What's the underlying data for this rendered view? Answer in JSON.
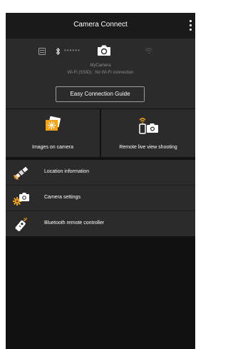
{
  "header": {
    "title": "Camera Connect"
  },
  "connection": {
    "dots": "••••••",
    "camera_name": "MyCamera",
    "ssid_line": "Wi-Fi (SSID) : No Wi-Fi connection",
    "guide_button": "Easy Connection Guide",
    "icons": [
      "camera-list-icon",
      "bluetooth-icon",
      "camera-icon",
      "wifi-icon"
    ]
  },
  "tiles": [
    {
      "label": "Images on camera",
      "icon": "images-icon"
    },
    {
      "label": "Remote live view shooting",
      "icon": "remote-live-view-icon"
    }
  ],
  "menu": [
    {
      "label": "Location information",
      "icon": "satellite-icon"
    },
    {
      "label": "Camera settings",
      "icon": "camera-settings-icon"
    },
    {
      "label": "Bluetooth remote controller",
      "icon": "bluetooth-remote-icon"
    }
  ],
  "colors": {
    "accent": "#f2a31a",
    "background": "#111111",
    "panel": "#2b2b2b"
  }
}
